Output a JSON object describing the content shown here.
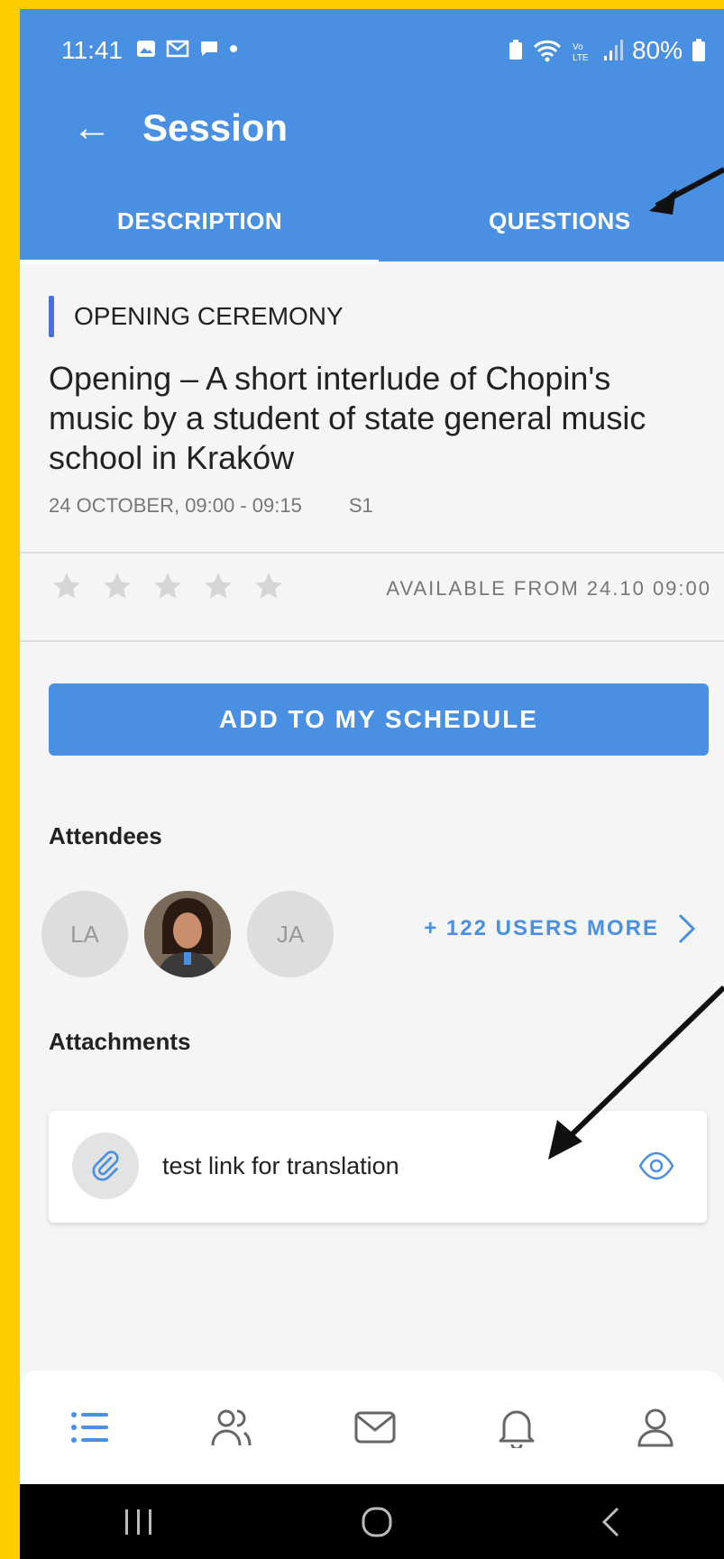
{
  "status_bar": {
    "time": "11:41",
    "battery": "80%"
  },
  "app_bar": {
    "title": "Session"
  },
  "tabs": [
    {
      "label": "DESCRIPTION",
      "active": true
    },
    {
      "label": "QUESTIONS",
      "active": false
    }
  ],
  "session": {
    "category": "OPENING CEREMONY",
    "title": "Opening – A short interlude of Chopin's music by a student of state general music school in Kraków",
    "date_time": "24 OCTOBER, 09:00 - 09:15",
    "room": "S1",
    "rating_stars": 5,
    "rating_availability": "AVAILABLE FROM 24.10 09:00"
  },
  "actions": {
    "add_schedule_label": "ADD TO MY SCHEDULE"
  },
  "attendees": {
    "heading": "Attendees",
    "list": [
      {
        "initials": "LA"
      },
      {
        "initials": ""
      },
      {
        "initials": "JA"
      }
    ],
    "more_label": "+ 122 USERS MORE"
  },
  "attachments": {
    "heading": "Attachments",
    "items": [
      {
        "name": "test link for translation"
      }
    ]
  },
  "colors": {
    "primary": "#4A90E2",
    "frame": "#FFCC00"
  }
}
